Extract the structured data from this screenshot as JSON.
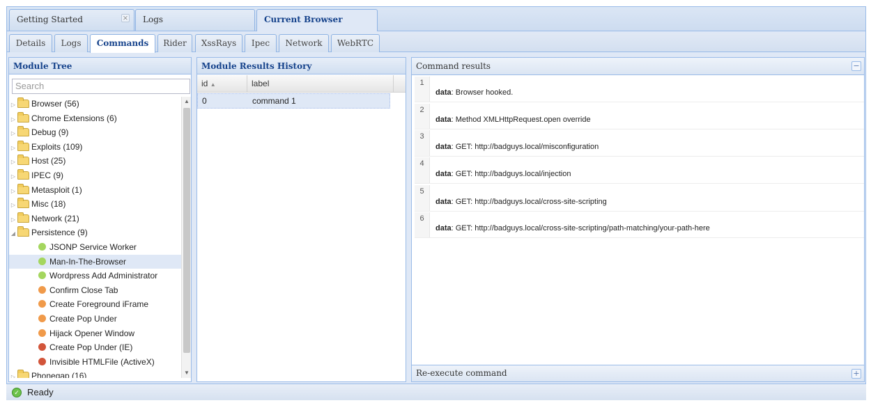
{
  "top_tabs": [
    {
      "label": "Getting Started",
      "closable": true
    },
    {
      "label": "Logs"
    },
    {
      "label": "Current Browser",
      "active": true
    }
  ],
  "sub_tabs": [
    {
      "label": "Details"
    },
    {
      "label": "Logs"
    },
    {
      "label": "Commands",
      "active": true
    },
    {
      "label": "Rider"
    },
    {
      "label": "XssRays"
    },
    {
      "label": "Ipec"
    },
    {
      "label": "Network"
    },
    {
      "label": "WebRTC"
    }
  ],
  "module_tree": {
    "title": "Module Tree",
    "search_placeholder": "Search",
    "folders_top": [
      "Browser (56)",
      "Chrome Extensions (6)",
      "Debug (9)",
      "Exploits (109)",
      "Host (25)",
      "IPEC (9)",
      "Metasploit (1)",
      "Misc (18)",
      "Network (21)"
    ],
    "open_folder": "Persistence (9)",
    "modules": [
      {
        "label": "JSONP Service Worker",
        "status": "green"
      },
      {
        "label": "Man-In-The-Browser",
        "status": "green",
        "selected": true
      },
      {
        "label": "Wordpress Add Administrator",
        "status": "green"
      },
      {
        "label": "Confirm Close Tab",
        "status": "orange"
      },
      {
        "label": "Create Foreground iFrame",
        "status": "orange"
      },
      {
        "label": "Create Pop Under",
        "status": "orange"
      },
      {
        "label": "Hijack Opener Window",
        "status": "orange"
      },
      {
        "label": "Create Pop Under (IE)",
        "status": "red"
      },
      {
        "label": "Invisible HTMLFile (ActiveX)",
        "status": "red"
      }
    ],
    "folders_bottom": [
      "Phonegap (16)"
    ]
  },
  "history": {
    "title": "Module Results History",
    "col_id": "id",
    "col_label": "label",
    "rows": [
      {
        "id": "0",
        "label": "command 1"
      }
    ]
  },
  "results": {
    "title": "Command results",
    "footer": "Re-execute command",
    "key": "data",
    "items": [
      {
        "n": "1",
        "value": "Browser hooked."
      },
      {
        "n": "2",
        "value": "Method XMLHttpRequest.open override"
      },
      {
        "n": "3",
        "value": "GET: http://badguys.local/misconfiguration"
      },
      {
        "n": "4",
        "value": "GET: http://badguys.local/injection"
      },
      {
        "n": "5",
        "value": "GET: http://badguys.local/cross-site-scripting"
      },
      {
        "n": "6",
        "value": "GET: http://badguys.local/cross-site-scripting/path-matching/your-path-here"
      }
    ]
  },
  "status": {
    "text": "Ready"
  },
  "colors": {
    "green": "#a4d65e",
    "orange": "#f09a4a",
    "red": "#d2553a",
    "accent": "#15428b"
  }
}
